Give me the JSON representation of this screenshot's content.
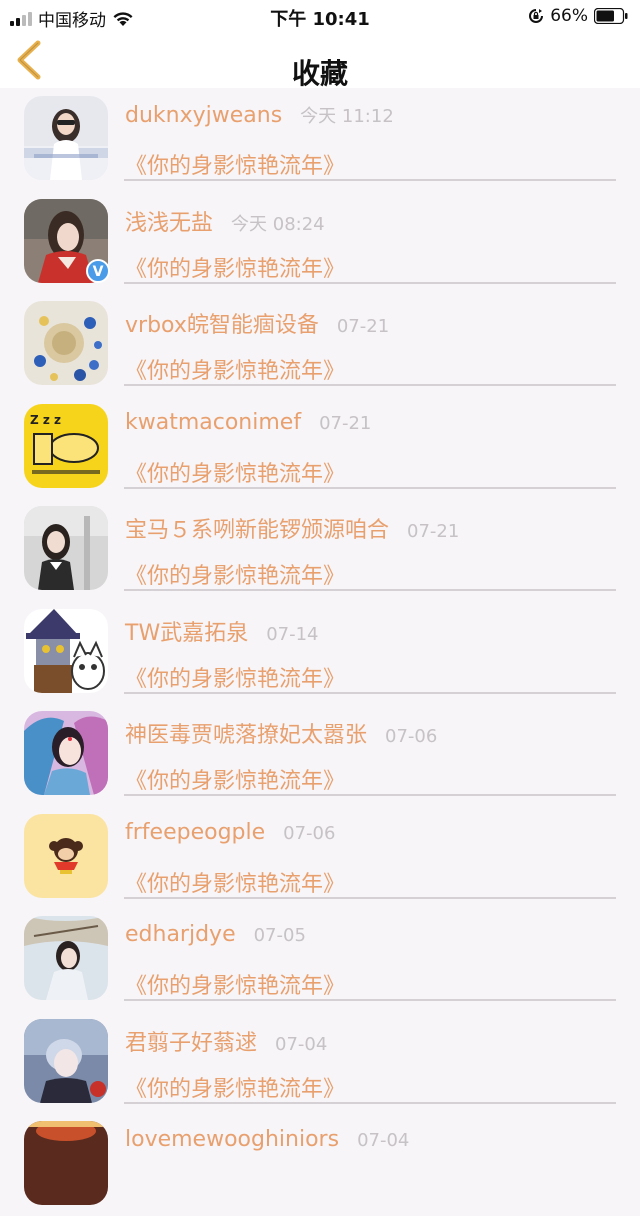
{
  "status_bar": {
    "carrier": "中国移动",
    "time": "下午 10:41",
    "battery": "66%"
  },
  "nav": {
    "title": "收藏",
    "back_icon": "chevron-left-icon"
  },
  "colors": {
    "accent": "#e8a06e",
    "back_arrow": "#e8b04a",
    "time_text": "#c6c2c6",
    "background": "#f7f5f8"
  },
  "items": [
    {
      "user": "duknxyjweans",
      "time": "今天 11:12",
      "work": "《你的身影惊艳流年》"
    },
    {
      "user": "浅浅无盐",
      "time": "今天 08:24",
      "work": "《你的身影惊艳流年》",
      "verified": "V"
    },
    {
      "user": "vrbox皖智能痼设备",
      "time": "07-21",
      "work": "《你的身影惊艳流年》"
    },
    {
      "user": "kwatmaconimef",
      "time": "07-21",
      "work": "《你的身影惊艳流年》"
    },
    {
      "user": "宝马５系咧新能锣颁源咱合",
      "time": "07-21",
      "work": "《你的身影惊艳流年》"
    },
    {
      "user": "TW武嘉拓泉",
      "time": "07-14",
      "work": "《你的身影惊艳流年》"
    },
    {
      "user": "神医毒贾唬落撩妃太嚣张",
      "time": "07-06",
      "work": "《你的身影惊艳流年》"
    },
    {
      "user": "frfeepeogple",
      "time": "07-06",
      "work": "《你的身影惊艳流年》"
    },
    {
      "user": "edharjdye",
      "time": "07-05",
      "work": "《你的身影惊艳流年》"
    },
    {
      "user": "君翦子好蓊逑",
      "time": "07-04",
      "work": "《你的身影惊艳流年》"
    },
    {
      "user": "lovemewooghiniors",
      "time": "07-04",
      "work": ""
    }
  ]
}
